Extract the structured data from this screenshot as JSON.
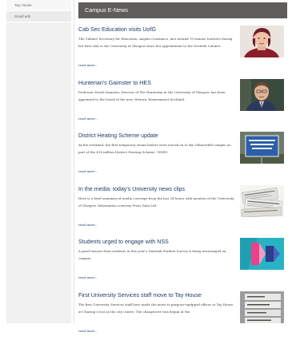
{
  "sidebar": {
    "items": [
      {
        "label": "Tay House"
      },
      {
        "label": "Small ads"
      }
    ]
  },
  "header": {
    "title": "Campus E-News"
  },
  "articles": [
    {
      "title": "Cab Sec Education visits UofG",
      "body": "The Cabinet Secretary for Education, Angela Constance, met around 70 trainee teachers during her first visit to the University of Glasgow since her appointment to the Scottish Cabinet.",
      "more": "read more...",
      "image_icon": "portrait-woman-icon"
    },
    {
      "title": "Hunterian's Gaimster to HES",
      "body": "Professor David Gaimster, Director of The Hunterian at the University of Glasgow, has been appointed to the board of the new, Historic Environment Scotland.",
      "more": "read more...",
      "image_icon": "portrait-man-icon"
    },
    {
      "title": "District Heating Scheme update",
      "body": "At the weekend, the first temporary steam boilers were moved on to the Gilmorehill campus as part of the £16 million District Heating Scheme. VIDEO",
      "more": "read more...",
      "image_icon": "sign-icon"
    },
    {
      "title": "In the media: today's University news clips",
      "body": "Here is a brief summary of media coverage from the last 24 hours with mention of the University of Glasgow. Information courtesy Press Data Ltd.",
      "more": "read more...",
      "image_icon": "newspapers-icon"
    },
    {
      "title": "Students urged to engage with NSS",
      "body": "A good turnout from students in this year's National Student Survey is being encouraged on campus.",
      "more": "read more...",
      "image_icon": "nss-graphic-icon"
    },
    {
      "title": "First University Services staff move to Tay House",
      "body": "The first University Services staff have made the move to purpose-equipped offices at Tay House at Charing Cross in the city centre. The changeover was begun at the",
      "more": "read more...",
      "image_icon": "building-directory-icon"
    }
  ]
}
